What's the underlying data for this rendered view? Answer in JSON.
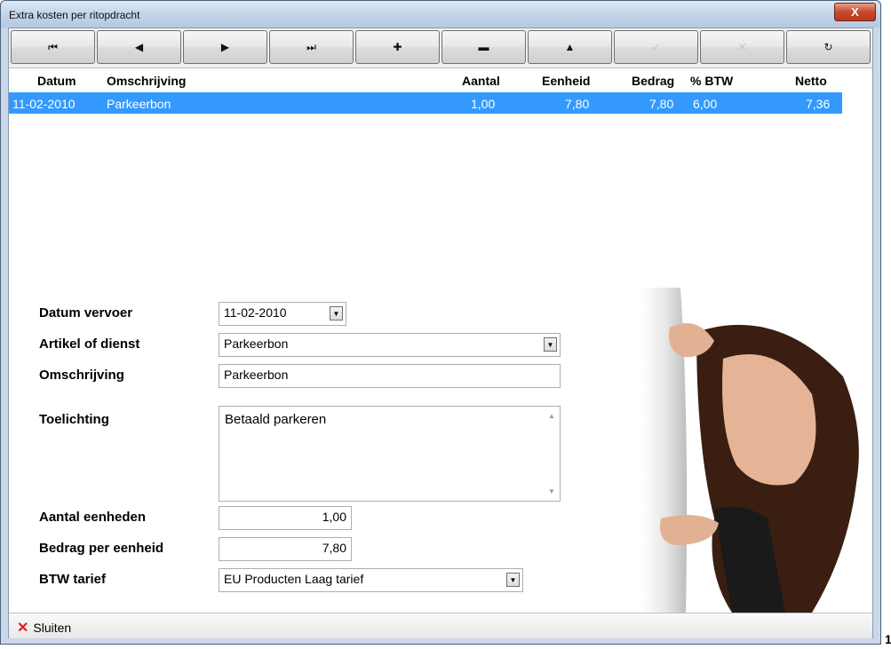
{
  "window": {
    "title": "Extra kosten per ritopdracht",
    "close_glyph": "X"
  },
  "toolbar": {
    "buttons": [
      {
        "name": "first-record-button",
        "glyph": "⏮",
        "enabled": true
      },
      {
        "name": "prev-record-button",
        "glyph": "◀",
        "enabled": true
      },
      {
        "name": "next-record-button",
        "glyph": "▶",
        "enabled": true
      },
      {
        "name": "last-record-button",
        "glyph": "⏭",
        "enabled": true
      },
      {
        "name": "add-record-button",
        "glyph": "✚",
        "enabled": true
      },
      {
        "name": "delete-record-button",
        "glyph": "▬",
        "enabled": true
      },
      {
        "name": "edit-record-button",
        "glyph": "▲",
        "enabled": true
      },
      {
        "name": "post-edit-button",
        "glyph": "✓",
        "enabled": false
      },
      {
        "name": "cancel-edit-button",
        "glyph": "✕",
        "enabled": false
      },
      {
        "name": "refresh-button",
        "glyph": "↻",
        "enabled": true
      }
    ]
  },
  "grid": {
    "columns": [
      "Datum",
      "Omschrijving",
      "Aantal",
      "Eenheid",
      "Bedrag",
      "% BTW",
      "Netto"
    ],
    "rows": [
      {
        "datum": "11-02-2010",
        "omschrijving": "Parkeerbon",
        "aantal": "1,00",
        "eenheid": "7,80",
        "bedrag": "7,80",
        "btw": "6,00",
        "netto": "7,36",
        "selected": true
      }
    ]
  },
  "form": {
    "datum_vervoer_label": "Datum vervoer",
    "datum_vervoer_value": "11-02-2010",
    "artikel_label": "Artikel of dienst",
    "artikel_value": "Parkeerbon",
    "omschrijving_label": "Omschrijving",
    "omschrijving_value": "Parkeerbon",
    "toelichting_label": "Toelichting",
    "toelichting_value": "Betaald parkeren",
    "aantal_label": "Aantal eenheden",
    "aantal_value": "1,00",
    "bedrag_label": "Bedrag per eenheid",
    "bedrag_value": "7,80",
    "btw_label": "BTW tarief",
    "btw_value": "EU Producten Laag tarief"
  },
  "statusbar": {
    "close_label": "Sluiten"
  },
  "corner_text": "1",
  "colors": {
    "selection": "#3399ff",
    "close_red": "#e02020"
  }
}
